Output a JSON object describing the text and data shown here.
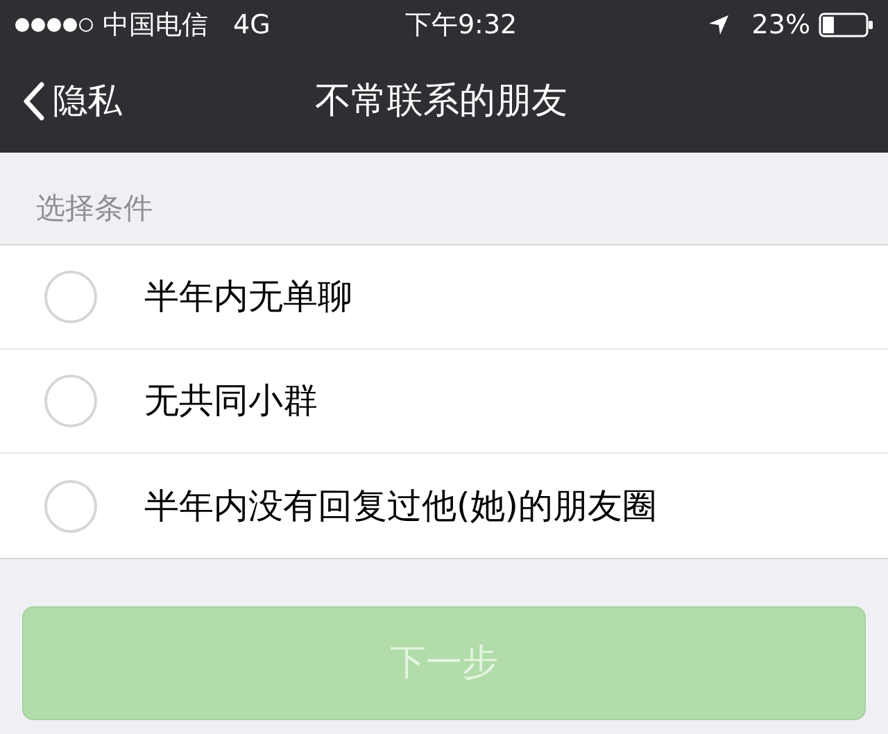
{
  "status_bar": {
    "carrier": "中国电信",
    "network": "4G",
    "time": "下午9:32",
    "battery": "23%"
  },
  "nav_bar": {
    "back": "隐私",
    "title": "不常联系的朋友"
  },
  "section_label": "选择条件",
  "options": [
    {
      "label": "半年内无单聊",
      "selected": false
    },
    {
      "label": "无共同小群",
      "selected": false
    },
    {
      "label": "半年内没有回复过他(她)的朋友圈",
      "selected": false
    }
  ],
  "next_button": {
    "label": "下一步",
    "disabled": true
  }
}
